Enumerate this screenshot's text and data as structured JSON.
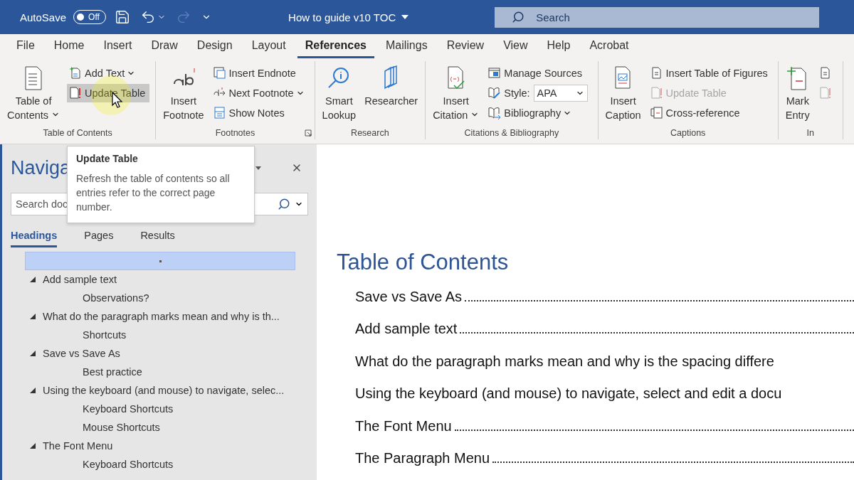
{
  "title_bar": {
    "autosave_label": "AutoSave",
    "autosave": {
      "on": false,
      "text": "Off"
    },
    "redo_disabled": true,
    "document_title": "How to guide v10 TOC",
    "search": {
      "placeholder": "Search"
    }
  },
  "tabs": [
    {
      "label": "File",
      "selected": false
    },
    {
      "label": "Home",
      "selected": false
    },
    {
      "label": "Insert",
      "selected": false
    },
    {
      "label": "Draw",
      "selected": false
    },
    {
      "label": "Design",
      "selected": false
    },
    {
      "label": "Layout",
      "selected": false
    },
    {
      "label": "References",
      "selected": true
    },
    {
      "label": "Mailings",
      "selected": false
    },
    {
      "label": "Review",
      "selected": false
    },
    {
      "label": "View",
      "selected": false
    },
    {
      "label": "Help",
      "selected": false
    },
    {
      "label": "Acrobat",
      "selected": false
    }
  ],
  "ribbon": [
    {
      "label": "Table of Contents",
      "launcher": false,
      "items": [
        {
          "kind": "large",
          "label": "Table of\nContents",
          "dropdown": true
        },
        {
          "kind": "stack",
          "items": [
            {
              "label": "Add Text",
              "dropdown": true,
              "disabled": false,
              "hovered": false
            },
            {
              "label": "Update Table",
              "dropdown": false,
              "disabled": false,
              "hovered": true
            }
          ]
        }
      ]
    },
    {
      "label": "Footnotes",
      "launcher": true,
      "items": [
        {
          "kind": "large",
          "label": "Insert\nFootnote",
          "dropdown": false
        },
        {
          "kind": "stack",
          "items": [
            {
              "label": "Insert Endnote",
              "dropdown": false,
              "disabled": false,
              "hovered": false
            },
            {
              "label": "Next Footnote",
              "dropdown": true,
              "disabled": false,
              "hovered": false
            },
            {
              "label": "Show Notes",
              "dropdown": false,
              "disabled": false,
              "hovered": false
            }
          ]
        }
      ]
    },
    {
      "label": "Research",
      "launcher": false,
      "items": [
        {
          "kind": "large",
          "label": "Smart\nLookup",
          "dropdown": false
        },
        {
          "kind": "large",
          "label": "Researcher",
          "dropdown": false
        }
      ]
    },
    {
      "label": "Citations & Bibliography",
      "launcher": false,
      "items": [
        {
          "kind": "large",
          "label": "Insert\nCitation",
          "dropdown": true
        },
        {
          "kind": "stack",
          "items": [
            {
              "label": "Manage Sources",
              "dropdown": false,
              "disabled": false,
              "hovered": false
            },
            {
              "label": "Style:",
              "select": "APA",
              "dropdown": false,
              "disabled": false,
              "hovered": false
            },
            {
              "label": "Bibliography",
              "dropdown": true,
              "disabled": false,
              "hovered": false
            }
          ]
        }
      ]
    },
    {
      "label": "Captions",
      "launcher": false,
      "items": [
        {
          "kind": "large",
          "label": "Insert\nCaption",
          "dropdown": false
        },
        {
          "kind": "stack",
          "items": [
            {
              "label": "Insert Table of Figures",
              "dropdown": false,
              "disabled": false,
              "hovered": false
            },
            {
              "label": "Update Table",
              "dropdown": false,
              "disabled": true,
              "hovered": false
            },
            {
              "label": "Cross-reference",
              "dropdown": false,
              "disabled": false,
              "hovered": false
            }
          ]
        }
      ]
    },
    {
      "label": "In",
      "launcher": false,
      "items": [
        {
          "kind": "large",
          "label": "Mark\nEntry",
          "dropdown": false
        },
        {
          "kind": "stack",
          "items": [
            {
              "dropdown": false,
              "disabled": false,
              "hovered": false
            },
            {
              "dropdown": false,
              "disabled": true,
              "hovered": false
            }
          ]
        }
      ]
    }
  ],
  "tooltip": {
    "title": "Update Table",
    "text": "Refresh the table of contents so all entries refer to the correct page number."
  },
  "navigation": {
    "title": "Naviga",
    "search": {
      "placeholder": "Search doc"
    },
    "tabs": [
      {
        "label": "Headings",
        "selected": true
      },
      {
        "label": "Pages",
        "selected": false
      },
      {
        "label": "Results",
        "selected": false
      }
    ],
    "tree": [
      {
        "kind": "empty",
        "selected": true
      },
      {
        "kind": "heading",
        "label": "Add sample text",
        "selected": false,
        "expanded": true,
        "children": [
          {
            "kind": "heading",
            "label": "Observations?",
            "selected": false
          }
        ]
      },
      {
        "kind": "heading",
        "label": "What do the paragraph marks mean and why is th...",
        "selected": false,
        "expanded": true,
        "children": [
          {
            "kind": "heading",
            "label": "Shortcuts",
            "selected": false
          }
        ]
      },
      {
        "kind": "heading",
        "label": "Save vs Save As",
        "selected": false,
        "expanded": true,
        "children": [
          {
            "kind": "heading",
            "label": "Best practice",
            "selected": false
          }
        ]
      },
      {
        "kind": "heading",
        "label": "Using the keyboard (and mouse) to navigate, selec...",
        "selected": false,
        "expanded": true,
        "children": [
          {
            "kind": "heading",
            "label": "Keyboard Shortcuts",
            "selected": false
          },
          {
            "kind": "heading",
            "label": "Mouse Shortcuts",
            "selected": false
          }
        ]
      },
      {
        "kind": "heading",
        "label": "The Font Menu",
        "selected": false,
        "expanded": true,
        "children": [
          {
            "kind": "heading",
            "label": "Keyboard Shortcuts",
            "selected": false
          }
        ]
      }
    ]
  },
  "document": {
    "heading": "Table of Contents",
    "entries": [
      {
        "text": "Save vs Save As",
        "leader": true
      },
      {
        "text": "Add sample text",
        "leader": true
      },
      {
        "text": "What do the paragraph marks mean and why is the spacing differe",
        "leader": false
      },
      {
        "text": "Using the keyboard (and mouse) to navigate, select and edit a docu",
        "leader": false
      },
      {
        "text": "The Font Menu",
        "leader": true
      },
      {
        "text": "The Paragraph Menu",
        "leader": true
      }
    ]
  }
}
